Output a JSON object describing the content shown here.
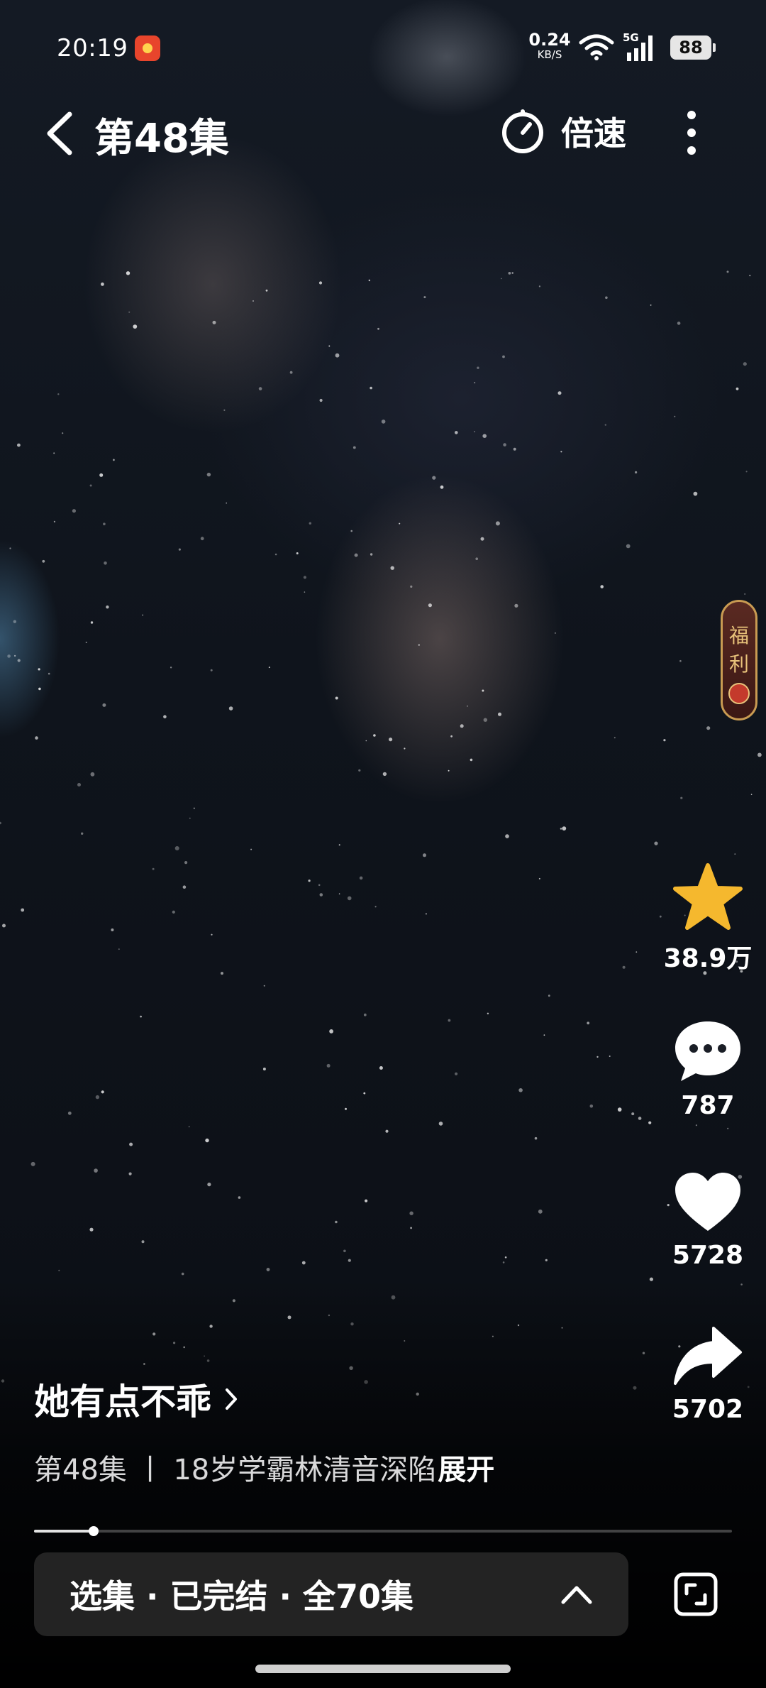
{
  "status_bar": {
    "time": "20:19",
    "net_speed_value": "0.24",
    "net_speed_unit": "KB/S",
    "network_type": "5G",
    "battery": "88"
  },
  "header": {
    "episode_title": "第48集",
    "speed_label": "倍速"
  },
  "welfare_tag": "福利",
  "actions": {
    "favorite_count": "38.9万",
    "comment_count": "787",
    "like_count": "5728",
    "share_count": "5702"
  },
  "caption": {
    "drama_title": "她有点不乖",
    "description": "第48集 丨 18岁学霸林清音深陷",
    "expand_label": "展开"
  },
  "progress": {
    "fraction": 0.085
  },
  "bottom_bar": {
    "episodes_label": "选集 · 已完结 · 全70集"
  },
  "colors": {
    "star": "#f5b82e",
    "bar_bg": "#232323",
    "welfare_gold": "#c99b52"
  }
}
